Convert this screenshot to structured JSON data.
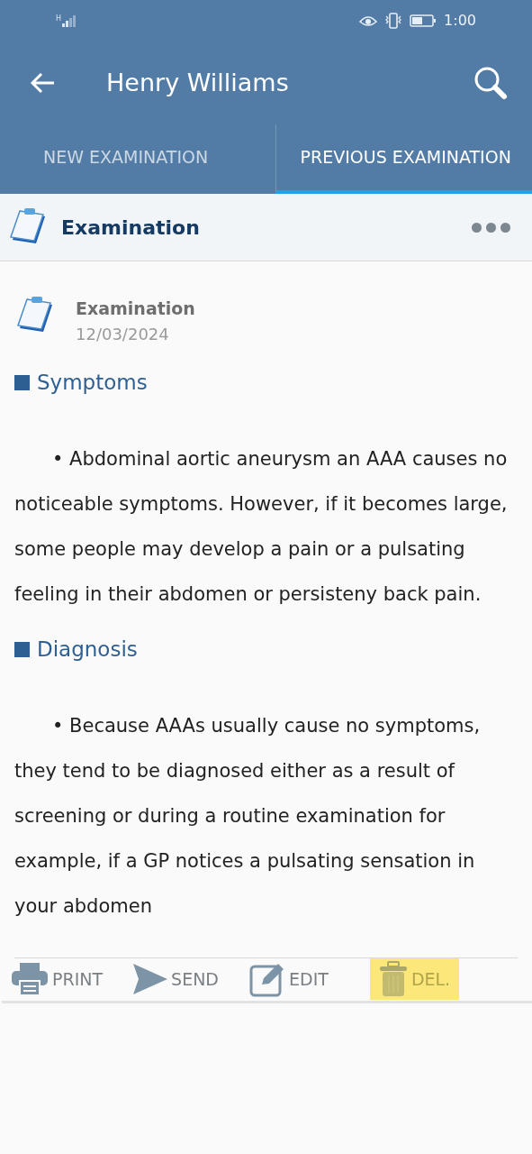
{
  "status_bar": {
    "time": "1:00",
    "network": "H"
  },
  "header": {
    "title": "Henry Williams"
  },
  "tabs": [
    {
      "label": "NEW EXAMINATION",
      "selected": false
    },
    {
      "label": "PREVIOUS EXAMINATION",
      "selected": true
    }
  ],
  "section_header": {
    "title": "Examination"
  },
  "record": {
    "title": "Examination",
    "date": "12/03/2024"
  },
  "sections": [
    {
      "heading": "Symptoms",
      "text": "• Abdominal aortic aneurysm an AAA causes no noticeable symptoms. However, if it becomes large, some people may develop a pain or a pulsating feeling in their abdomen or persisteny back pain."
    },
    {
      "heading": "Diagnosis",
      "text": "• Because AAAs usually cause no symptoms, they tend to be diagnosed either as a result of screening or during a routine examination for example, if a GP notices a pulsating sensation in your abdomen"
    }
  ],
  "actions": [
    {
      "kind": "print",
      "label": "PRINT",
      "highlighted": false
    },
    {
      "kind": "send",
      "label": "SEND",
      "highlighted": false
    },
    {
      "kind": "edit",
      "label": "EDIT",
      "highlighted": false
    },
    {
      "kind": "delete",
      "label": "DEL.",
      "highlighted": true
    }
  ]
}
